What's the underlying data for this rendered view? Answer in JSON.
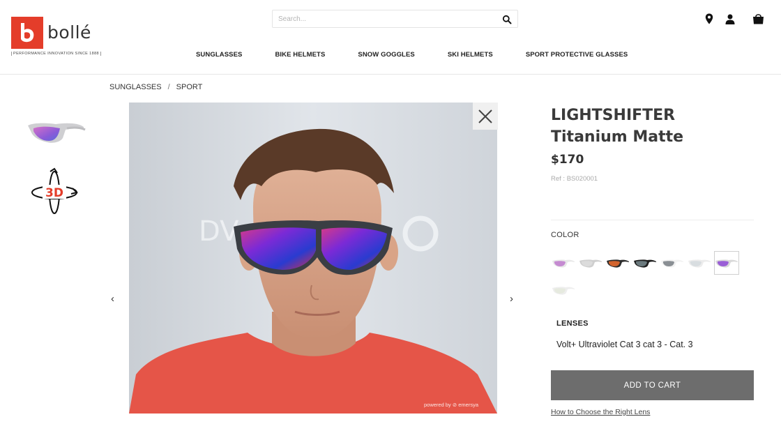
{
  "brand": {
    "name": "bollé",
    "tagline": "PERFORMANCE INNOVATION SINCE 1888",
    "accent_color": "#e43d2a"
  },
  "search": {
    "placeholder": "Search...",
    "icon": "search-icon"
  },
  "nav": {
    "items": [
      {
        "label": "SUNGLASSES"
      },
      {
        "label": "BIKE HELMETS"
      },
      {
        "label": "SNOW GOGGLES"
      },
      {
        "label": "SKI HELMETS"
      },
      {
        "label": "SPORT PROTECTIVE GLASSES"
      }
    ]
  },
  "header_icons": [
    "location-pin-icon",
    "user-icon",
    "shopping-bag-icon"
  ],
  "breadcrumb": {
    "items": [
      "SUNGLASSES",
      "SPORT"
    ],
    "separator": "/"
  },
  "thumbnails": [
    {
      "name": "sunglasses-thumbnail"
    },
    {
      "name": "3d-view-icon",
      "label": "3D"
    }
  ],
  "stage": {
    "powered_by": "powered by ⊘ emersya",
    "prev_arrow": "‹",
    "next_arrow": "›"
  },
  "product": {
    "title_line1": "LIGHTSHIFTER",
    "title_line2": "Titanium Matte",
    "price": "$170",
    "ref": "Ref : BS020001",
    "color_label": "COLOR",
    "swatches": [
      {
        "lens": "#c58bd1",
        "frame": "#e8e8e8",
        "selected": false
      },
      {
        "lens": "#dcdcdc",
        "frame": "#cfcfcf",
        "selected": false
      },
      {
        "lens": "#d2642e",
        "frame": "#2d2d2d",
        "selected": false
      },
      {
        "lens": "#6b7a7e",
        "frame": "#1f1f1f",
        "selected": false
      },
      {
        "lens": "#8a8f94",
        "frame": "#f2f2f2",
        "selected": false
      },
      {
        "lens": "#d8dde0",
        "frame": "#ececec",
        "selected": false
      },
      {
        "lens": "#9a5fd6",
        "frame": "#d9d9d9",
        "selected": true
      },
      {
        "lens": "#e6eadf",
        "frame": "#eeeeee",
        "selected": false
      }
    ],
    "lenses_label": "LENSES",
    "lenses_value": "Volt+ Ultraviolet Cat 3 cat 3 - Cat. 3",
    "add_to_cart": "ADD TO CART",
    "lens_link": "How to Choose the Right Lens"
  }
}
